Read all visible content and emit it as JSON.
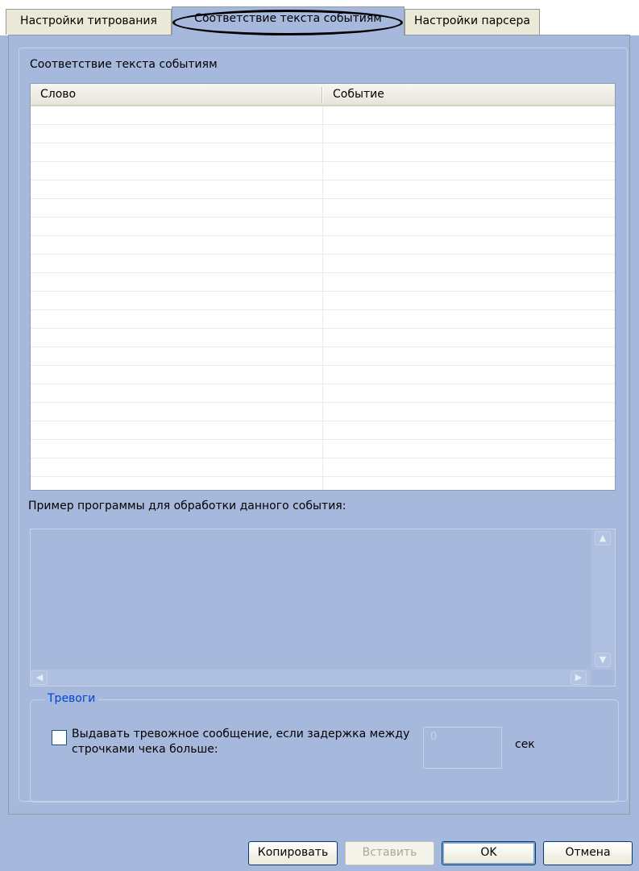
{
  "tabs": [
    {
      "label": "Настройки титрования"
    },
    {
      "label": "Соответствие текста событиям"
    },
    {
      "label": "Настройки парсера"
    }
  ],
  "mapping": {
    "title": "Соответствие текста событиям",
    "columns": [
      "Слово",
      "Событие"
    ],
    "rows": []
  },
  "example": {
    "label": "Пример программы для обработки данного события:",
    "value": ""
  },
  "alarms": {
    "group_title": "Тревоги",
    "checkbox_label": "Выдавать тревожное сообщение, если задержка между строчками чека больше:",
    "checked": false,
    "delay_value": "0",
    "unit": "сек"
  },
  "buttons": {
    "copy": "Копировать",
    "paste": "Вставить",
    "ok": "OK",
    "cancel": "Отмена"
  },
  "scroll_icons": {
    "up": "▲",
    "down": "▼",
    "left": "◀",
    "right": "▶"
  }
}
